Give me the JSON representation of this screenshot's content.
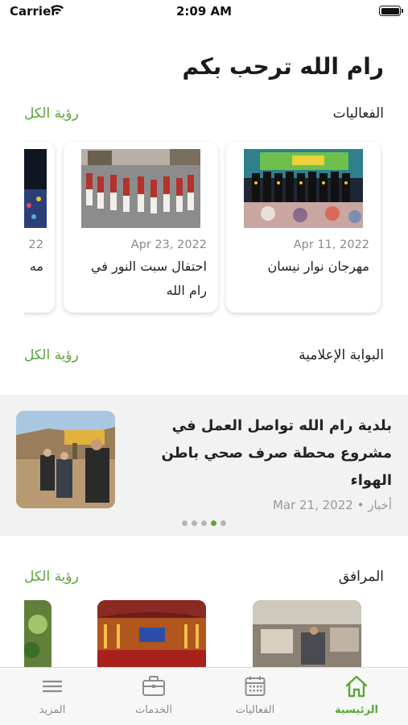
{
  "status_bar": {
    "carrier": "Carrier",
    "time": "2:09 AM"
  },
  "header": {
    "title": "رام الله ترحب بكم"
  },
  "events": {
    "title": "الفعاليات",
    "see_all": "رؤية الكل",
    "cards": [
      {
        "date": "Apr 11, 2022",
        "title": "مهرجان نوار نيسان"
      },
      {
        "date": "Apr 23, 2022",
        "title": "احتفال سبت النور في رام الله"
      },
      {
        "date": "22",
        "title": "مه"
      }
    ]
  },
  "media": {
    "title": "البوابة الإعلامية",
    "see_all": "رؤية الكل",
    "article": {
      "title": "بلدية رام الله تواصل العمل في مشروع محطة صرف صحي  باطن الهواء",
      "category": "أخبار",
      "date": "Mar 21, 2022"
    },
    "dots": 5,
    "active_dot": 4
  },
  "facilities": {
    "title": "المرافق",
    "see_all": "رؤية الكل"
  },
  "tabs": [
    {
      "label": "الرئيسية",
      "icon": "home-icon",
      "active": true
    },
    {
      "label": "الفعاليات",
      "icon": "calendar-icon",
      "active": false
    },
    {
      "label": "الخدمات",
      "icon": "briefcase-icon",
      "active": false
    },
    {
      "label": "المزيد",
      "icon": "menu-icon",
      "active": false
    }
  ],
  "colors": {
    "accent": "#5ba63a",
    "text": "#222222",
    "muted": "#8a8a8a",
    "news_bg": "#f2f2f2"
  }
}
